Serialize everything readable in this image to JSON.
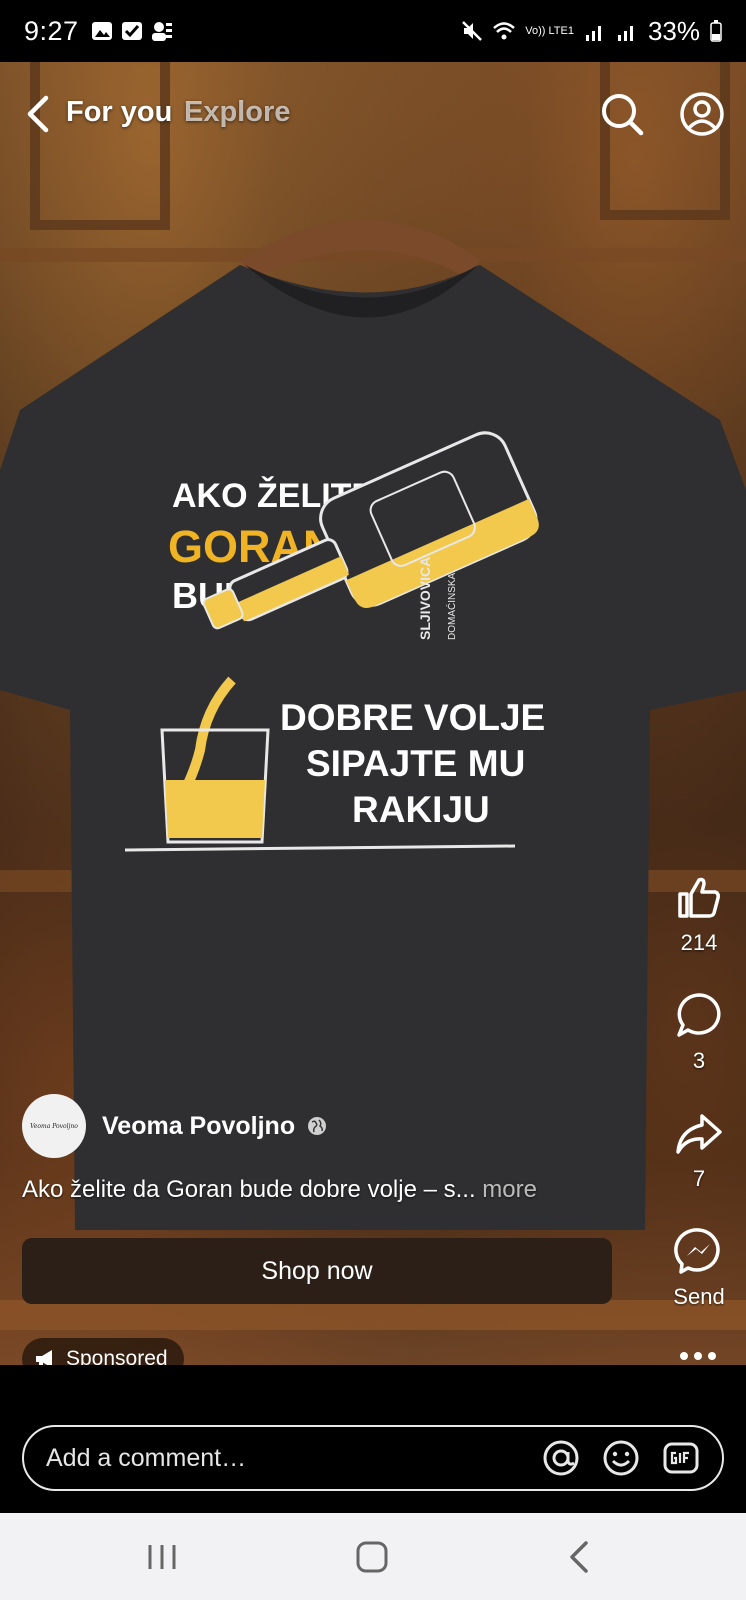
{
  "status_bar": {
    "time": "9:27",
    "battery": "33%",
    "network": "Vo)) LTE1"
  },
  "nav": {
    "tab_foryou": "For you",
    "tab_explore": "Explore"
  },
  "artwork": {
    "line1": "AKO ŽELITE DA",
    "line2": "GORAN",
    "line3": "BUDE",
    "line4": "DOBRE VOLJE",
    "line5": "SIPAJTE MU",
    "line6": "RAKIJU",
    "bottle_label": "SLJIVOVICA",
    "bottle_sublabel": "DOMAĆINSKA",
    "accent_color": "#f0b323"
  },
  "actions": {
    "likes": "214",
    "comments": "3",
    "shares": "7",
    "send_label": "Send"
  },
  "post": {
    "author": "Veoma Povoljno",
    "avatar_text": "Veoma Povoljno",
    "caption": "Ako želite da Goran bude dobre volje – s...",
    "caption_more": "more",
    "cta": "Shop now",
    "sponsored": "Sponsored"
  },
  "comment": {
    "placeholder": "Add a comment…"
  }
}
